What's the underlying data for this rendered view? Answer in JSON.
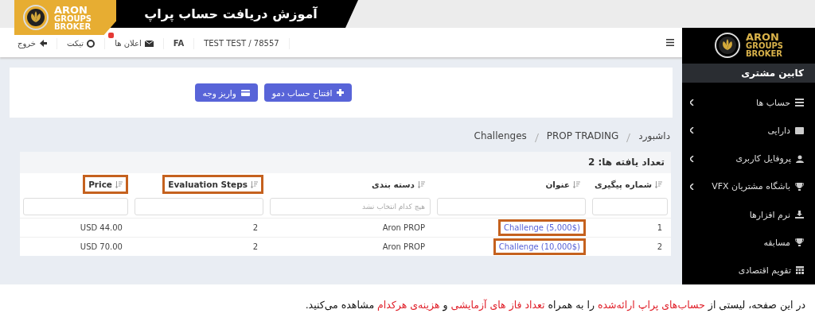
{
  "banner": {
    "logo_lines": [
      "ARON",
      "GROUPS",
      "BROKER"
    ],
    "title": "آموزش دریافت حساب پراپ"
  },
  "topbar": {
    "items": [
      {
        "label": "TEST TEST / 78557",
        "badge": false
      },
      {
        "label": "FA",
        "badge": false
      },
      {
        "label": "اعلان ها",
        "badge": true
      },
      {
        "label": "تیکت",
        "badge": false
      },
      {
        "label": "خروج",
        "badge": false
      }
    ]
  },
  "sidebar": {
    "logo_lines": [
      "ARON",
      "GROUPS",
      "BROKER"
    ],
    "section": "کابین مشتری",
    "items": [
      {
        "label": "حساب ها",
        "has_submenu": true
      },
      {
        "label": "دارایی",
        "has_submenu": true
      },
      {
        "label": "پروفایل کاربری",
        "has_submenu": true
      },
      {
        "label": "باشگاه مشتریان VFX",
        "has_submenu": true
      },
      {
        "label": "نرم افزارها",
        "has_submenu": false
      },
      {
        "label": "مسابقه",
        "has_submenu": false
      },
      {
        "label": "تقویم اقتصادی",
        "has_submenu": false
      }
    ]
  },
  "actions": [
    {
      "label": "افتتاح حساب دمو"
    },
    {
      "label": "واریز وجه"
    }
  ],
  "breadcrumb": [
    "داشبورد",
    "PROP TRADING",
    "Challenges"
  ],
  "table": {
    "count_label": "تعداد یافته ها: 2",
    "columns": [
      {
        "label": "شماره پیگیری",
        "highlighted": false
      },
      {
        "label": "عنوان",
        "highlighted": false
      },
      {
        "label": "دسته بندی",
        "highlighted": false,
        "placeholder": "هیچ کدام انتخاب نشد"
      },
      {
        "label": "Evaluation Steps",
        "highlighted": true
      },
      {
        "label": "Price",
        "highlighted": true
      }
    ],
    "rows": [
      {
        "cells": [
          {
            "text": "1",
            "link": false,
            "highlighted": false
          },
          {
            "text": "Challenge (5,000$)",
            "link": true,
            "highlighted": true
          },
          {
            "text": "Aron PROP",
            "link": false,
            "highlighted": false
          },
          {
            "text": "2",
            "link": false,
            "highlighted": false
          },
          {
            "text": "USD 44.00",
            "link": false,
            "highlighted": false
          }
        ]
      },
      {
        "cells": [
          {
            "text": "2",
            "link": false,
            "highlighted": false
          },
          {
            "text": "Challenge (10,000$)",
            "link": true,
            "highlighted": true
          },
          {
            "text": "Aron PROP",
            "link": false,
            "highlighted": false
          },
          {
            "text": "2",
            "link": false,
            "highlighted": false
          },
          {
            "text": "USD 70.00",
            "link": false,
            "highlighted": false
          }
        ]
      }
    ]
  },
  "caption": {
    "segments": [
      {
        "text": "در این صفحه، لیستی از ",
        "highlight": false
      },
      {
        "text": "حساب‌های پراپ ارائه‌شده",
        "highlight": true
      },
      {
        "text": " را به همراه ",
        "highlight": false
      },
      {
        "text": "تعداد فاز های آزمایشی",
        "highlight": true
      },
      {
        "text": " و ",
        "highlight": false
      },
      {
        "text": "هزینه‌ی هرکدام",
        "highlight": true
      },
      {
        "text": " مشاهده می‌کنید.",
        "highlight": false
      }
    ]
  }
}
